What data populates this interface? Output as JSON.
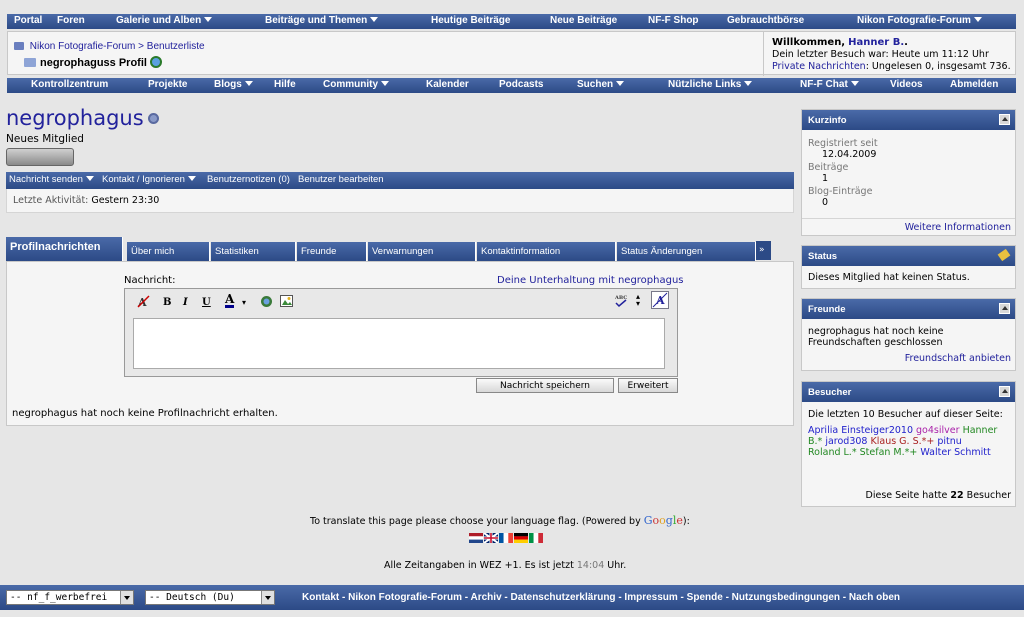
{
  "topnav": [
    {
      "label": "Portal",
      "dropdown": false
    },
    {
      "label": "Foren",
      "dropdown": false
    },
    {
      "label": "Galerie und Alben",
      "dropdown": true
    },
    {
      "label": "Beiträge und Themen",
      "dropdown": true
    },
    {
      "label": "Heutige Beiträge",
      "dropdown": false
    },
    {
      "label": "Neue Beiträge",
      "dropdown": false
    },
    {
      "label": "NF-F Shop",
      "dropdown": false
    },
    {
      "label": "Gebrauchtbörse",
      "dropdown": false
    },
    {
      "label": "Nikon Fotografie-Forum",
      "dropdown": true
    }
  ],
  "breadcrumb": {
    "root": "Nikon Fotografie-Forum",
    "sep": ">",
    "parent": "Benutzerliste",
    "current": "negrophaguss Profil"
  },
  "welcome": {
    "greeting": "Willkommen,",
    "user": "Hanner B.",
    "greeting_end": ".",
    "last_visit": "Dein letzter Besuch war: Heute um 11:12 Uhr",
    "pm_label": "Private Nachrichten",
    "pm_text": ": Ungelesen 0, insgesamt 736."
  },
  "subnav": [
    {
      "label": "Kontrollzentrum",
      "dropdown": false
    },
    {
      "label": "Projekte",
      "dropdown": false
    },
    {
      "label": "Blogs",
      "dropdown": true
    },
    {
      "label": "Hilfe",
      "dropdown": false
    },
    {
      "label": "Community",
      "dropdown": true
    },
    {
      "label": "Kalender",
      "dropdown": false
    },
    {
      "label": "Podcasts",
      "dropdown": false
    },
    {
      "label": "Suchen",
      "dropdown": true
    },
    {
      "label": "Nützliche Links",
      "dropdown": true
    },
    {
      "label": "NF-F Chat",
      "dropdown": true
    },
    {
      "label": "Videos",
      "dropdown": false
    },
    {
      "label": "Abmelden",
      "dropdown": false
    }
  ],
  "profile": {
    "username": "negrophagus",
    "usertitle": "Neues Mitglied",
    "actions": [
      "Nachricht senden",
      "Kontakt / Ignorieren",
      "Benutzernotizen (0)",
      "Benutzer bearbeiten"
    ],
    "activity_label": "Letzte Aktivität:",
    "activity_value": "Gestern 23:30"
  },
  "tabs": [
    "Profilnachrichten",
    "Über mich",
    "Statistiken",
    "Freunde",
    "Verwarnungen",
    "Kontaktinformation",
    "Status Änderungen"
  ],
  "tab_more": "»",
  "message_form": {
    "label": "Nachricht:",
    "conversation_link": "Deine Unterhaltung mit negrophagus",
    "bold": "B",
    "italic": "I",
    "underline": "U",
    "color": "A",
    "save_button": "Nachricht speichern",
    "advanced_button": "Erweitert",
    "no_messages": "negrophagus hat noch keine Profilnachricht erhalten."
  },
  "sidebar": {
    "kurzinfo": {
      "title": "Kurzinfo",
      "registered_label": "Registriert seit",
      "registered_value": "12.04.2009",
      "posts_label": "Beiträge",
      "posts_value": "1",
      "blog_label": "Blog-Einträge",
      "blog_value": "0",
      "more_link": "Weitere Informationen"
    },
    "status": {
      "title": "Status",
      "text": "Dieses Mitglied hat keinen Status."
    },
    "friends": {
      "title": "Freunde",
      "text": "negrophagus hat noch keine Freundschaften geschlossen",
      "link": "Freundschaft anbieten"
    },
    "visitors": {
      "title": "Besucher",
      "intro": "Die letzten 10 Besucher auf dieser Seite:",
      "names": [
        {
          "name": "Aprilia",
          "color": "#2222cc"
        },
        {
          "name": "Einsteiger2010",
          "color": "#2222cc"
        },
        {
          "name": "go4silver",
          "color": "#aa22aa"
        },
        {
          "name": "Hanner B.*",
          "color": "#228822"
        },
        {
          "name": "jarod308",
          "color": "#2222cc"
        },
        {
          "name": "Klaus G. S.*+",
          "color": "#aa2222"
        },
        {
          "name": "pitnu",
          "color": "#2222cc"
        },
        {
          "name": "Roland L.*",
          "color": "#228822"
        },
        {
          "name": "Stefan M.*+",
          "color": "#228822"
        },
        {
          "name": "Walter Schmitt",
          "color": "#2222cc"
        }
      ],
      "footer_pre": "Diese Seite hatte",
      "footer_count": "22",
      "footer_post": "Besucher"
    }
  },
  "translate": {
    "text": "To translate this page please choose your language flag. (Powered by",
    "google": "Google",
    "end": "):"
  },
  "timezone": {
    "text": "Alle Zeitangaben in WEZ +1. Es ist jetzt",
    "time": "14:04",
    "end": "Uhr."
  },
  "footer": {
    "style_select": "-- nf_f_werbefrei",
    "lang_select": "-- Deutsch (Du)",
    "links": "Kontakt - Nikon Fotografie-Forum - Archiv - Datenschutzerklärung - Impressum - Spende - Nutzungsbedingungen - Nach oben"
  },
  "colors": {
    "nav_blue": "#2c4a86",
    "link_blue": "#22229c",
    "page_bg": "#e6e6e6"
  }
}
